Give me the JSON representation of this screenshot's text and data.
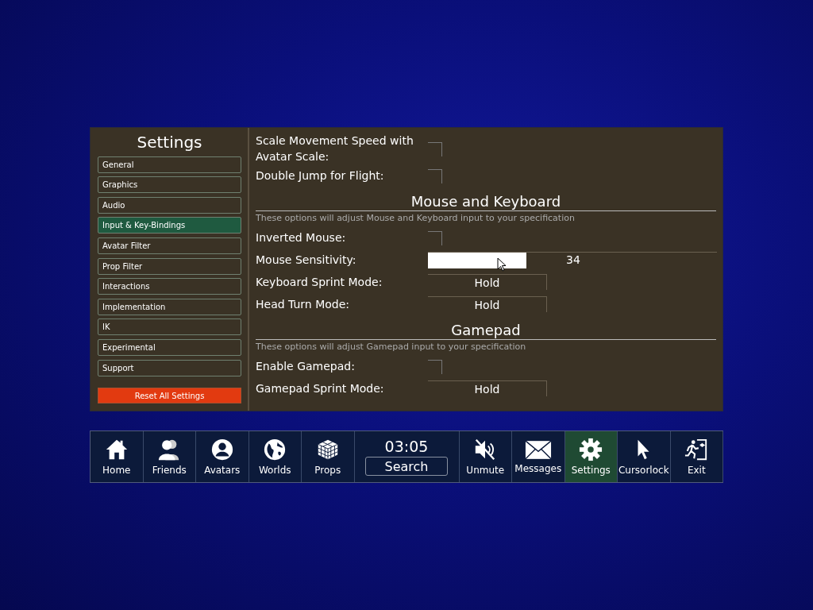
{
  "sidebar": {
    "title": "Settings",
    "items": [
      {
        "label": "General",
        "selected": false
      },
      {
        "label": "Graphics",
        "selected": false
      },
      {
        "label": "Audio",
        "selected": false
      },
      {
        "label": "Input & Key-Bindings",
        "selected": true
      },
      {
        "label": "Avatar Filter",
        "selected": false
      },
      {
        "label": "Prop Filter",
        "selected": false
      },
      {
        "label": "Interactions",
        "selected": false
      },
      {
        "label": "Implementation",
        "selected": false
      },
      {
        "label": "IK",
        "selected": false
      },
      {
        "label": "Experimental",
        "selected": false
      },
      {
        "label": "Support",
        "selected": false
      }
    ],
    "reset_button": "Reset All Settings"
  },
  "content": [
    {
      "kind": "checkbox",
      "label": "Scale Movement Speed with Avatar Scale:",
      "checked": false
    },
    {
      "kind": "checkbox",
      "label": "Double Jump for Flight:",
      "checked": false
    },
    {
      "kind": "section",
      "title": "Mouse and Keyboard",
      "description": "These options will adjust Mouse and Keyboard input to your specification"
    },
    {
      "kind": "checkbox",
      "label": "Inverted Mouse:",
      "checked": false
    },
    {
      "kind": "slider",
      "label": "Mouse Sensitivity:",
      "level": 0.34,
      "reading": "34"
    },
    {
      "kind": "dropdown",
      "label": "Keyboard Sprint Mode:",
      "value": "Hold"
    },
    {
      "kind": "dropdown",
      "label": "Head Turn Mode:",
      "value": "Hold"
    },
    {
      "kind": "section",
      "title": "Gamepad",
      "description": "These options will adjust Gamepad input to your specification"
    },
    {
      "kind": "checkbox",
      "label": "Enable Gamepad:",
      "checked": false
    },
    {
      "kind": "dropdown",
      "label": "Gamepad Sprint Mode:",
      "value": "Hold"
    }
  ],
  "dock": {
    "items": [
      {
        "kind": "home",
        "label": "Home",
        "selected": false
      },
      {
        "kind": "friends",
        "label": "Friends",
        "selected": false
      },
      {
        "kind": "avatar",
        "label": "Avatars",
        "selected": false
      },
      {
        "kind": "globe",
        "label": "Worlds",
        "selected": false
      },
      {
        "kind": "cube",
        "label": "Props",
        "selected": false
      },
      {
        "kind": "clock",
        "time": "03:05",
        "search": "Search"
      },
      {
        "kind": "mute",
        "label": "Unmute",
        "selected": false
      },
      {
        "kind": "mail",
        "label": "Messages",
        "selected": false
      },
      {
        "kind": "gear",
        "label": "Settings",
        "selected": true
      },
      {
        "kind": "cursor",
        "label": "Cursorlock",
        "selected": false
      },
      {
        "kind": "exit",
        "label": "Exit",
        "selected": false
      }
    ]
  }
}
